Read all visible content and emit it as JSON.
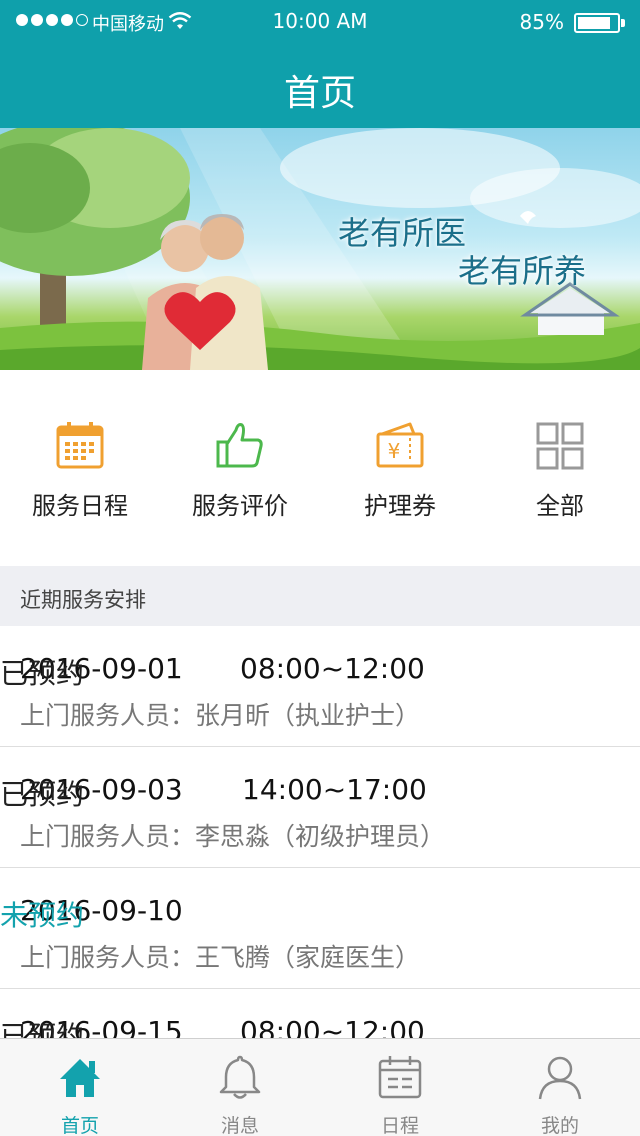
{
  "status_bar": {
    "carrier": "中国移动",
    "time": "10:00 AM",
    "battery": "85%",
    "battery_level": 0.85
  },
  "header": {
    "title": "首页"
  },
  "banner": {
    "slogan_line1": "老有所医",
    "slogan_line2": "老有所养"
  },
  "quick_menu": [
    {
      "label": "服务日程",
      "icon": "calendar-icon",
      "color": "#f0a030"
    },
    {
      "label": "服务评价",
      "icon": "thumbs-up-icon",
      "color": "#4cb84c"
    },
    {
      "label": "护理券",
      "icon": "voucher-icon",
      "color": "#f0a030"
    },
    {
      "label": "全部",
      "icon": "grid-icon",
      "color": "#999999"
    }
  ],
  "section": {
    "title": "近期服务安排"
  },
  "schedule": [
    {
      "date": "2016-09-01",
      "time": "08:00~12:00",
      "status": "已预约",
      "staff": "上门服务人员：张月昕（执业护士）"
    },
    {
      "date": "2016-09-03",
      "time": "14:00~17:00",
      "status": "已预约",
      "staff": "上门服务人员：李思淼（初级护理员）"
    },
    {
      "date": "2016-09-10",
      "time": "",
      "status": "未预约",
      "staff": "上门服务人员：王飞腾（家庭医生）"
    },
    {
      "date": "2016-09-15",
      "time": "08:00~12:00",
      "status": "已预约",
      "staff": ""
    }
  ],
  "tab_bar": [
    {
      "label": "首页",
      "icon": "home-icon",
      "active": true
    },
    {
      "label": "消息",
      "icon": "bell-icon",
      "active": false
    },
    {
      "label": "日程",
      "icon": "calendar-icon",
      "active": false
    },
    {
      "label": "我的",
      "icon": "user-icon",
      "active": false
    }
  ],
  "colors": {
    "accent": "#13a2ad",
    "header": "#0fa0ab",
    "orange": "#f0a030",
    "green": "#4cb84c"
  }
}
